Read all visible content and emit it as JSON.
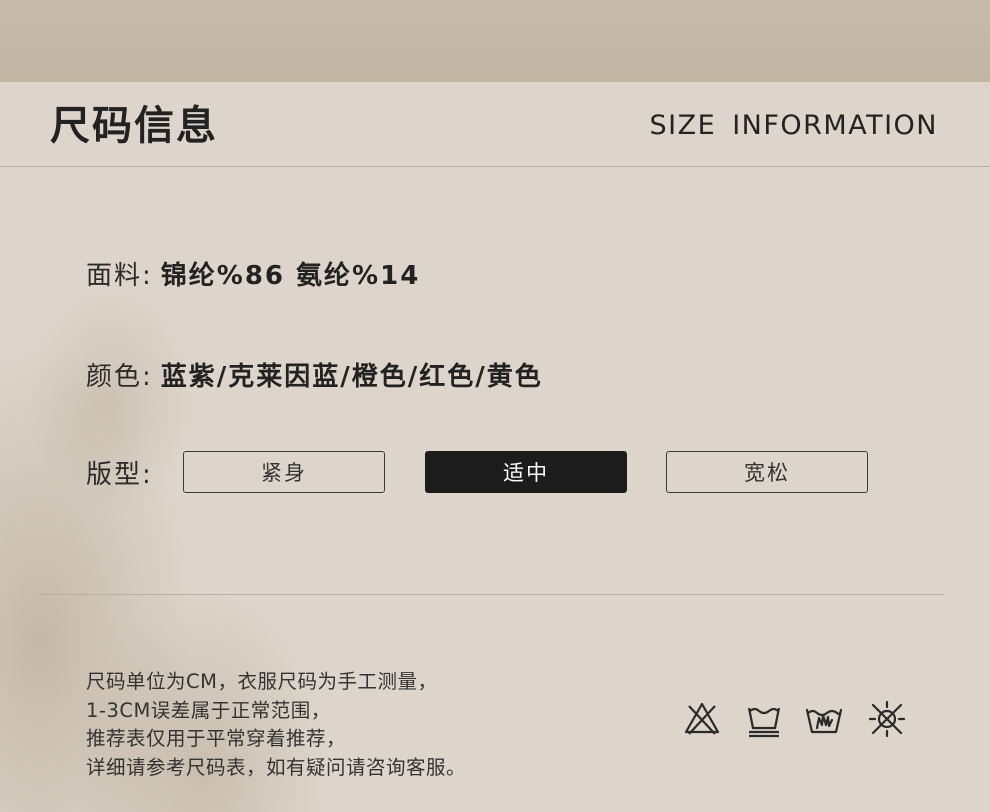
{
  "header": {
    "title_cn": "尺码信息",
    "title_en": "SIZE  INFORMATION"
  },
  "specs": {
    "fabric": {
      "label": "面料:",
      "value": "锦纶%86 氨纶%14"
    },
    "color": {
      "label": "颜色:",
      "value": "蓝紫/克莱因蓝/橙色/红色/黄色"
    },
    "fit": {
      "label": "版型:",
      "options": [
        {
          "label": "紧身",
          "selected": false
        },
        {
          "label": "适中",
          "selected": true
        },
        {
          "label": "宽松",
          "selected": false
        }
      ]
    }
  },
  "notes": [
    "尺码单位为CM，衣服尺码为手工测量，",
    "1-3CM误差属于正常范围，",
    "推荐表仅用于平常穿着推荐，",
    "详细请参考尺码表，如有疑问请咨询客服。"
  ],
  "care_icons": [
    "no-bleach-icon",
    "wash-icon",
    "hand-wash-icon",
    "no-tumble-dry-icon"
  ],
  "colors": {
    "background": "#ddd5cb",
    "top_band": "#c3b5a4",
    "text": "#262626",
    "selected_bg": "#1c1c1c",
    "selected_text": "#ffffff"
  }
}
